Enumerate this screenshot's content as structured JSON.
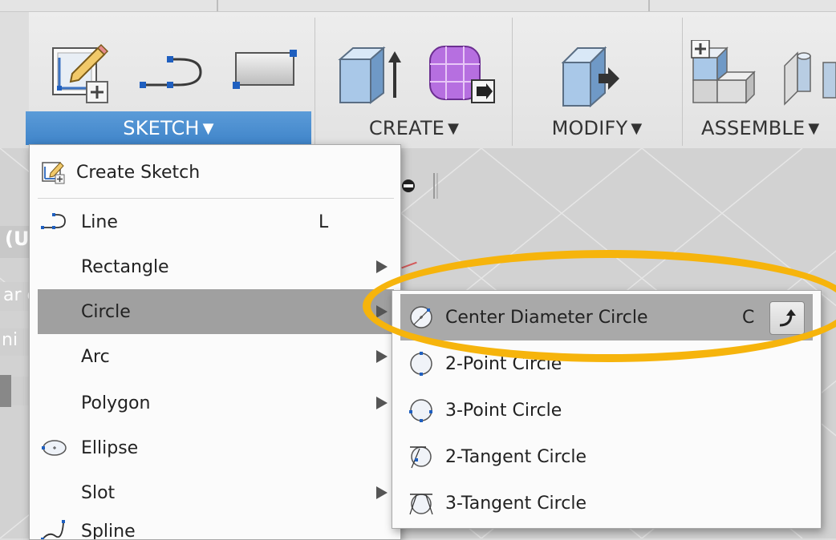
{
  "toolbar": {
    "groups": [
      {
        "label": "SKETCH",
        "arrow": "▼",
        "active": true
      },
      {
        "label": "CREATE",
        "arrow": "▼",
        "active": false
      },
      {
        "label": "MODIFY",
        "arrow": "▼",
        "active": false
      },
      {
        "label": "ASSEMBLE",
        "arrow": "▼",
        "active": false
      }
    ],
    "icons": [
      "create-sketch-icon",
      "line-icon",
      "rectangle-icon",
      "extrude-icon",
      "form-icon",
      "press-pull-icon",
      "new-component-icon",
      "joint-icon"
    ]
  },
  "browser": {
    "unsaved_fragment": "(Unsaved)",
    "named_views_fragment": "ar ed Views",
    "origin_fragment": "ni"
  },
  "sketch_menu": {
    "items": [
      {
        "label": "Create Sketch",
        "icon": "create-sketch-icon",
        "shortcut": "",
        "has_submenu": false
      },
      {
        "label": "Line",
        "icon": "line-icon",
        "shortcut": "L",
        "has_submenu": false
      },
      {
        "label": "Rectangle",
        "icon": "",
        "shortcut": "",
        "has_submenu": true
      },
      {
        "label": "Circle",
        "icon": "",
        "shortcut": "",
        "has_submenu": true,
        "highlighted": true
      },
      {
        "label": "Arc",
        "icon": "",
        "shortcut": "",
        "has_submenu": true
      },
      {
        "label": "Polygon",
        "icon": "",
        "shortcut": "",
        "has_submenu": true
      },
      {
        "label": "Ellipse",
        "icon": "ellipse-icon",
        "shortcut": "",
        "has_submenu": false
      },
      {
        "label": "Slot",
        "icon": "",
        "shortcut": "",
        "has_submenu": true
      },
      {
        "label": "Spline",
        "icon": "spline-icon",
        "shortcut": "",
        "has_submenu": false
      }
    ]
  },
  "circle_submenu": {
    "items": [
      {
        "label": "Center Diameter Circle",
        "icon": "center-diameter-circle-icon",
        "shortcut": "C",
        "highlighted": true
      },
      {
        "label": "2-Point Circle",
        "icon": "two-point-circle-icon",
        "shortcut": ""
      },
      {
        "label": "3-Point Circle",
        "icon": "three-point-circle-icon",
        "shortcut": ""
      },
      {
        "label": "2-Tangent Circle",
        "icon": "two-tangent-circle-icon",
        "shortcut": ""
      },
      {
        "label": "3-Tangent Circle",
        "icon": "three-tangent-circle-icon",
        "shortcut": ""
      }
    ]
  },
  "colors": {
    "accent_blue": "#3f84c9",
    "highlight_ellipse": "#f6b40c",
    "menu_highlight": "#a0a0a0"
  }
}
